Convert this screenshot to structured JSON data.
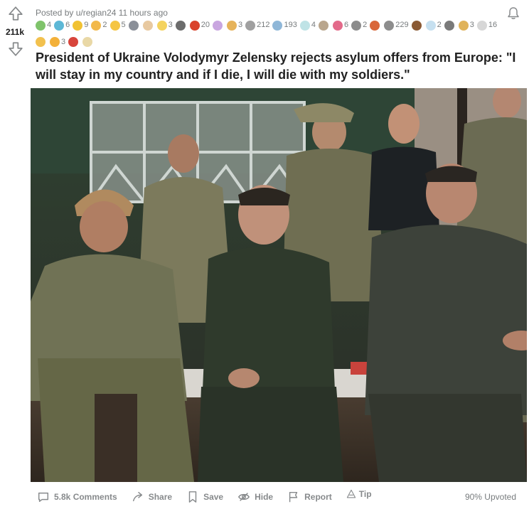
{
  "post": {
    "score": "211k",
    "meta": "Posted by u/regian24 11 hours ago",
    "title": "President of Ukraine Volodymyr Zelensky rejects asylum offers from Europe: \"I will stay in my country and if I die, I will die with my soldiers.\"",
    "upvoted": "90% Upvoted"
  },
  "awards": [
    {
      "icon": "wholesome-award-icon",
      "count": "4",
      "color": "#7fc36b"
    },
    {
      "icon": "helpful-award-icon",
      "count": "6",
      "color": "#5db8d6"
    },
    {
      "icon": "gold-award-icon",
      "count": "9",
      "color": "#f1c232"
    },
    {
      "icon": "hand-award-icon",
      "count": "2",
      "color": "#f2b94b"
    },
    {
      "icon": "hugz-award-icon",
      "count": "5",
      "color": "#f5c542"
    },
    {
      "icon": "rocket-award-icon",
      "count": "",
      "color": "#8a8f98"
    },
    {
      "icon": "hands-award-icon",
      "count": "",
      "color": "#e8c9a0"
    },
    {
      "icon": "bless-award-icon",
      "count": "3",
      "color": "#f4d35e"
    },
    {
      "icon": "bird-award-icon",
      "count": "",
      "color": "#6c6c6c"
    },
    {
      "icon": "medal-award-icon",
      "count": "20",
      "color": "#d9422b"
    },
    {
      "icon": "butterfly-award-icon",
      "count": "",
      "color": "#c9a6e0"
    },
    {
      "icon": "cheers-award-icon",
      "count": "3",
      "color": "#e6b35a"
    },
    {
      "icon": "salute-award-icon",
      "count": "212",
      "color": "#a0a0a0"
    },
    {
      "icon": "tears-award-icon",
      "count": "193",
      "color": "#8fb7d8"
    },
    {
      "icon": "angel-award-icon",
      "count": "4",
      "color": "#bfe3e6"
    },
    {
      "icon": "sloth-award-icon",
      "count": "",
      "color": "#b9a68d"
    },
    {
      "icon": "heart-award-icon",
      "count": "6",
      "color": "#e36a8a"
    },
    {
      "icon": "pull-up-award-icon",
      "count": "2",
      "color": "#8c8c8c"
    },
    {
      "icon": "party-award-icon",
      "count": "",
      "color": "#d9673a"
    },
    {
      "icon": "silver-award-icon",
      "count": "229",
      "color": "#8d8d8d"
    },
    {
      "icon": "bear-award-icon",
      "count": "",
      "color": "#8a5a34"
    },
    {
      "icon": "starstruck-award-icon",
      "count": "2",
      "color": "#c6e0f0"
    },
    {
      "icon": "castle-award-icon",
      "count": "",
      "color": "#7a7a7a"
    },
    {
      "icon": "doge-award-icon",
      "count": "3",
      "color": "#e0b35a"
    },
    {
      "icon": "bunny-award-icon",
      "count": "16",
      "color": "#d7d7d7"
    },
    {
      "icon": "clap-award-icon",
      "count": "",
      "color": "#f2c14e"
    },
    {
      "icon": "bell-award-icon",
      "count": "3",
      "color": "#f3b13a"
    },
    {
      "icon": "cat-award-icon",
      "count": "",
      "color": "#d8453b"
    },
    {
      "icon": "dog-award-icon",
      "count": "",
      "color": "#e9d8a6"
    }
  ],
  "actions": {
    "comments": "5.8k Comments",
    "share": "Share",
    "save": "Save",
    "hide": "Hide",
    "report": "Report",
    "tip": "Tip"
  },
  "colors": {
    "muted": "#878a8c",
    "title": "#222222"
  }
}
